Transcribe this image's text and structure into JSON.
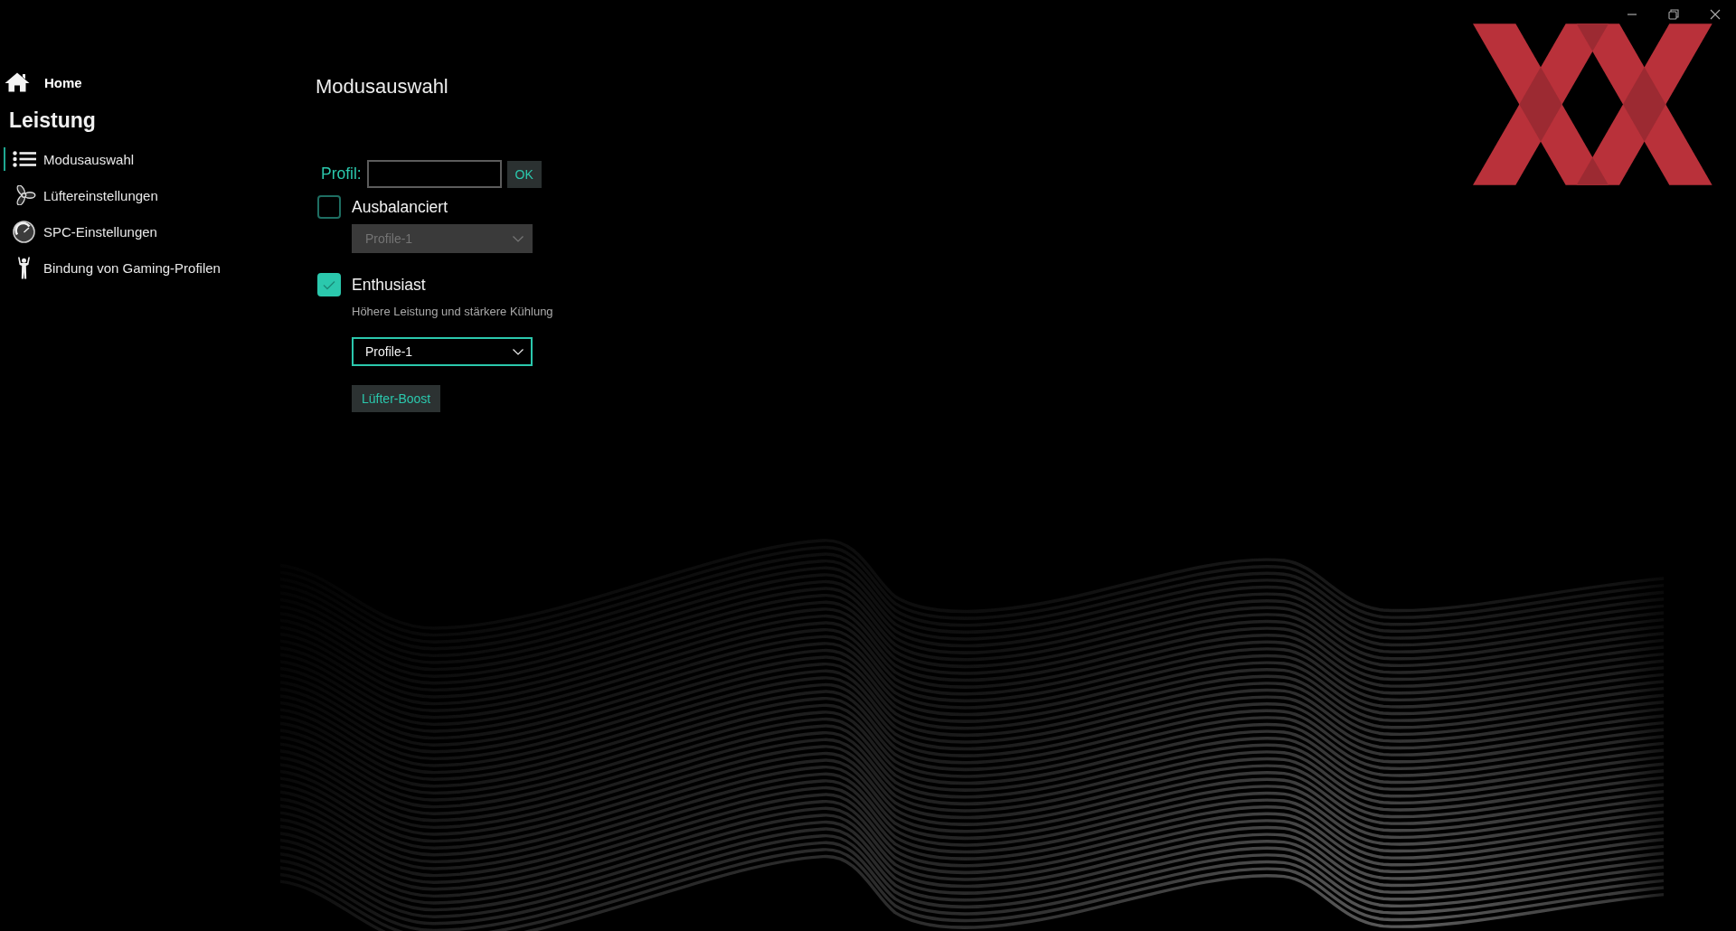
{
  "sidebar": {
    "home": {
      "label": "Home"
    },
    "section": "Leistung",
    "items": [
      {
        "label": "Modusauswahl",
        "selected": true
      },
      {
        "label": "Lüftereinstellungen",
        "selected": false
      },
      {
        "label": "SPC-Einstellungen",
        "selected": false
      },
      {
        "label": "Bindung von Gaming-Profilen",
        "selected": false
      }
    ]
  },
  "page": {
    "title": "Modusauswahl",
    "profile": {
      "label": "Profil:",
      "button": "OK"
    },
    "modes": [
      {
        "label": "Ausbalanciert",
        "checked": false,
        "dropdown": {
          "value": "Profile-1",
          "disabled": true
        }
      },
      {
        "label": "Enthusiast",
        "checked": true,
        "description": "Höhere Leistung und stärkere Kühlung",
        "dropdown": {
          "value": "Profile-1",
          "disabled": false
        },
        "button": "Lüfter-Boost"
      }
    ]
  }
}
